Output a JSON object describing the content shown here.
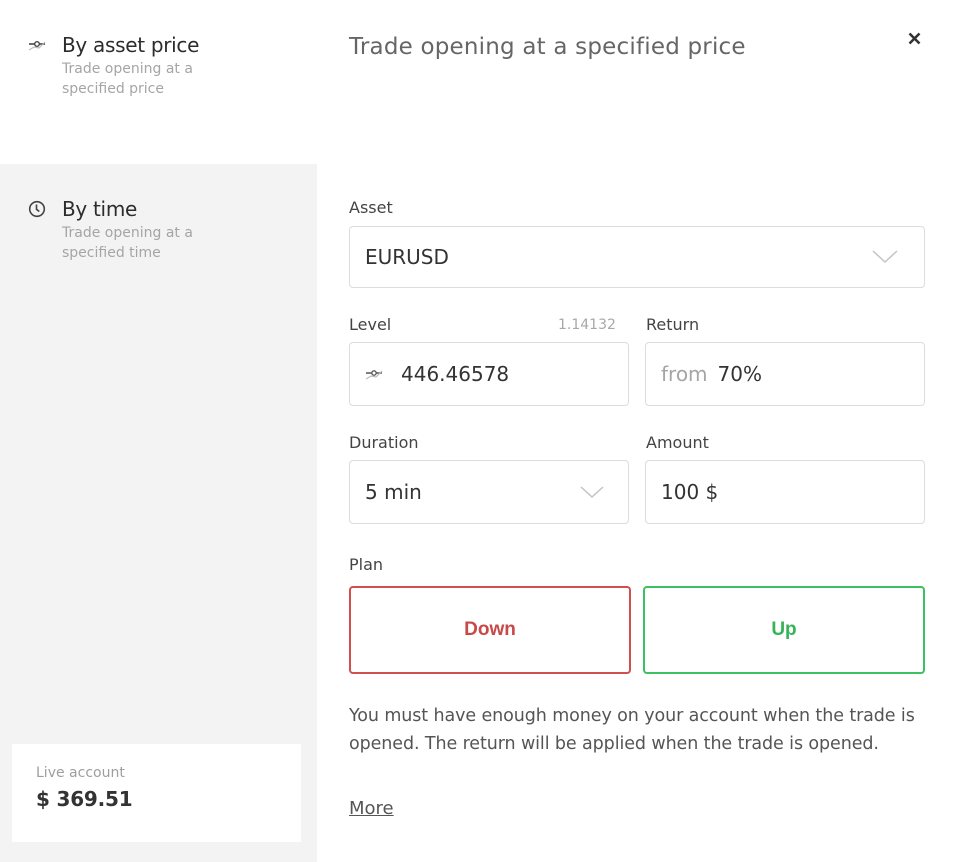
{
  "sidebar": {
    "modes": [
      {
        "icon": "price-level-icon",
        "title": "By asset price",
        "subtitle": "Trade opening at a specified price",
        "active": true
      },
      {
        "icon": "clock-icon",
        "title": "By time",
        "subtitle": "Trade opening at a specified time",
        "active": false
      }
    ],
    "account": {
      "label": "Live account",
      "balance": "$ 369.51"
    }
  },
  "dialog": {
    "title": "Trade opening at a specified price",
    "close_icon": "close-icon"
  },
  "form": {
    "asset": {
      "label": "Asset",
      "value": "EURUSD"
    },
    "level": {
      "label": "Level",
      "current_price": "1.14132",
      "value": "446.46578"
    },
    "return": {
      "label": "Return",
      "prefix": "from",
      "value": "70%"
    },
    "duration": {
      "label": "Duration",
      "value": "5 min"
    },
    "amount": {
      "label": "Amount",
      "value": "100 $"
    },
    "plan": {
      "label": "Plan",
      "down_label": "Down",
      "up_label": "Up"
    }
  },
  "notice": {
    "text": "You must have enough money on your account when the trade is opened. The return will be applied when the trade is opened.",
    "more_label": "More"
  },
  "colors": {
    "down": "#d05050",
    "up": "#3cc160",
    "sidebar_bg": "#f3f3f3"
  }
}
